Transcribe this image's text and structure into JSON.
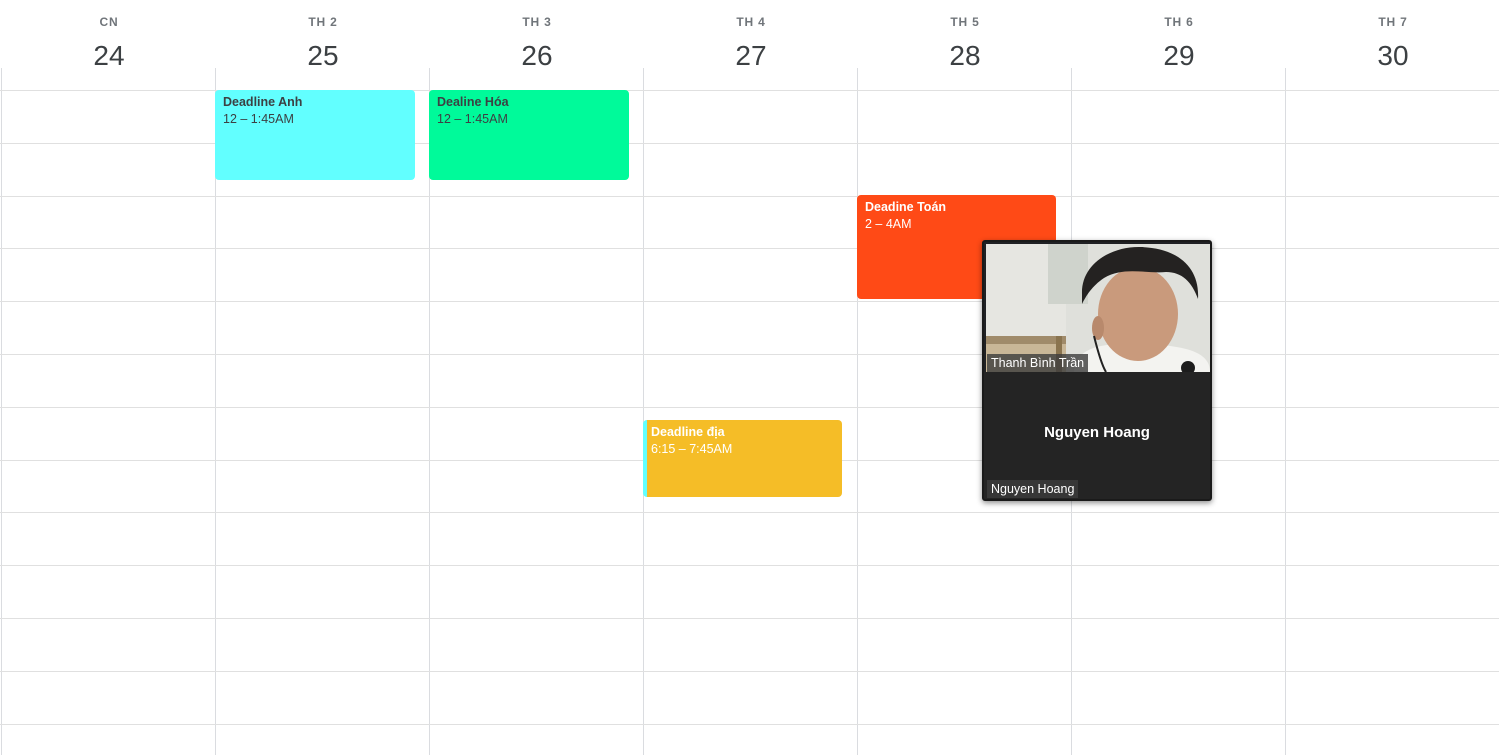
{
  "days": [
    {
      "name": "CN",
      "num": "24"
    },
    {
      "name": "TH 2",
      "num": "25"
    },
    {
      "name": "TH 3",
      "num": "26"
    },
    {
      "name": "TH 4",
      "num": "27"
    },
    {
      "name": "TH 5",
      "num": "28"
    },
    {
      "name": "TH 6",
      "num": "29"
    },
    {
      "name": "TH 7",
      "num": "30"
    }
  ],
  "events": [
    {
      "title": "Deadline Anh",
      "time": "12 – 1:45AM",
      "color": "#62ffff"
    },
    {
      "title": "Dealine Hóa",
      "time": "12 – 1:45AM",
      "color": "#00fa9a"
    },
    {
      "title": "Deadine Toán",
      "time": "2 – 4AM",
      "color": "#ff4a16"
    },
    {
      "title": "Deadline địa",
      "time": "6:15 – 7:45AM",
      "color": "#f5bd27",
      "accent": "#62ffff"
    }
  ],
  "call": {
    "participant_video_name": "Thanh Bình Trần",
    "self_name_center": "Nguyen Hoang",
    "self_name_tag": "Nguyen Hoang",
    "icons": [
      "person-video-icon"
    ]
  },
  "colors": {
    "grid_line": "#dadce0",
    "pip_background": "#202124"
  }
}
